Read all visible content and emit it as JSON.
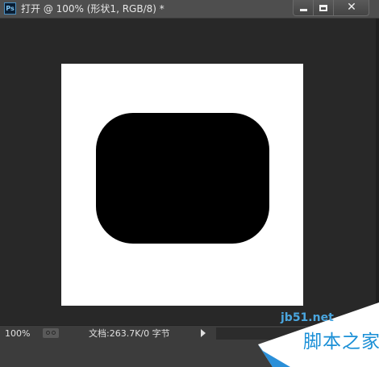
{
  "window": {
    "app_icon": "Ps",
    "title": "打开 @ 100% (形状1, RGB/8) *",
    "controls": {
      "minimize": "minimize-icon",
      "maximize": "maximize-icon",
      "close": "✕"
    }
  },
  "canvas": {
    "document_color": "#ffffff",
    "shape_color": "#000000",
    "shape": "rounded-rectangle"
  },
  "status_bar": {
    "zoom": "100%",
    "doc_info": "文档:263.7K/0 字节",
    "menu_arrow": "arrow-right-icon"
  },
  "watermark": {
    "url": "jb51.net",
    "name": "脚本之家"
  }
}
